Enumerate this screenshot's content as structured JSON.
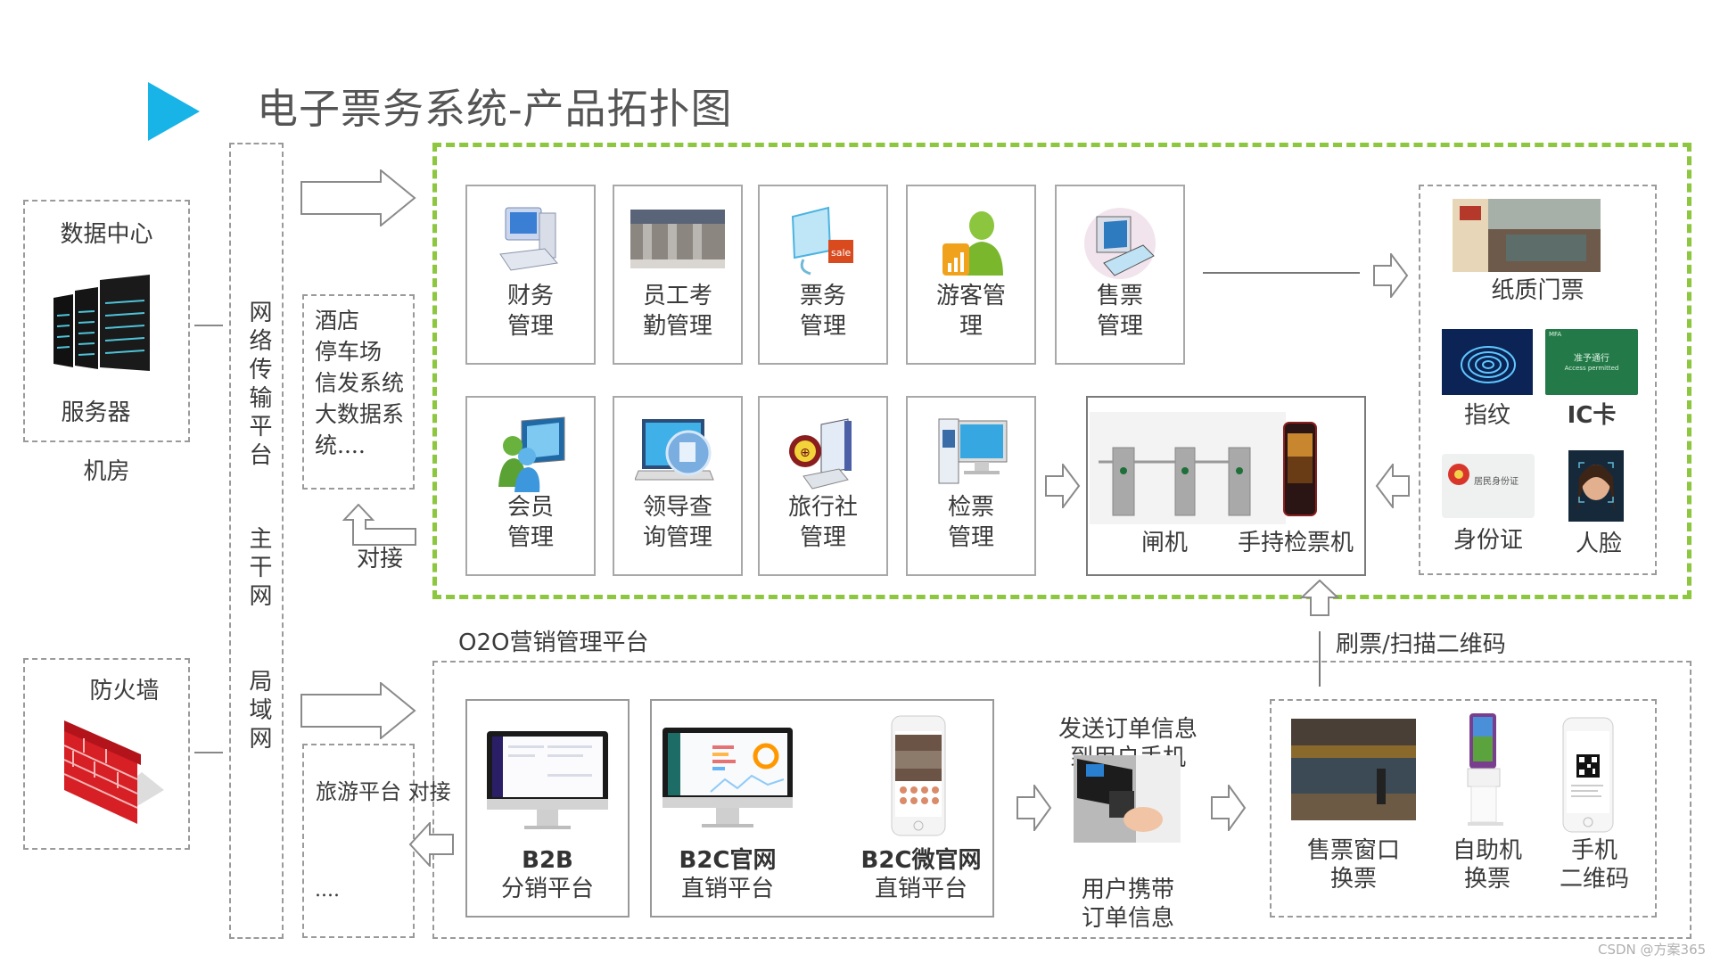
{
  "title": "电子票务系统-产品拓扑图",
  "colors": {
    "accent": "#18B4E8",
    "frame_green": "#8DC63F",
    "dash_gray": "#9a9a9a",
    "text": "#3a3a3a"
  },
  "left": {
    "data_center": {
      "title": "数据中心",
      "server_label": "服务器",
      "caption": "机房"
    },
    "firewall": {
      "title": "防火墙"
    }
  },
  "network_column": {
    "segments": [
      "网络传输平台",
      "主干网",
      "局域网"
    ]
  },
  "external_systems": {
    "lines": [
      "酒店",
      "停车场",
      "信发系统",
      "大数据系",
      "统...."
    ],
    "connect_label": "对接"
  },
  "travel_platform": {
    "label": "旅游平台",
    "connect_label": "对接",
    "more": "...."
  },
  "management_modules": {
    "top_row": [
      {
        "label": "财务\n管理",
        "icon": "computer-icon"
      },
      {
        "label": "员工考\n勤管理",
        "icon": "turnstile-photo-icon"
      },
      {
        "label": "票务\n管理",
        "icon": "monitor-sale-icon"
      },
      {
        "label": "游客管\n理",
        "icon": "visitor-chart-icon"
      },
      {
        "label": "售票\n管理",
        "icon": "ticket-terminal-icon"
      }
    ],
    "bottom_row": [
      {
        "label": "会员\n管理",
        "icon": "member-users-icon"
      },
      {
        "label": "领导查\n询管理",
        "icon": "query-laptop-icon"
      },
      {
        "label": "旅行社\n管理",
        "icon": "travel-agency-pc-icon"
      },
      {
        "label": "检票\n管理",
        "icon": "check-kiosk-icon"
      }
    ]
  },
  "devices": {
    "gate_label": "闸机",
    "handheld_label": "手持检票机"
  },
  "ticket_media": {
    "paper": "纸质门票",
    "fingerprint": "指纹",
    "ic_card": "IC卡",
    "ic_card_text_cn": "准予通行",
    "ic_card_text_en": "Access permitted",
    "ic_card_corner": "MFA",
    "id_card": "身份证",
    "id_card_text": "居民身份证",
    "face": "人脸"
  },
  "o2o": {
    "title": "O2O营销管理平台",
    "b2b": {
      "head": "B2B",
      "sub": "分销平台"
    },
    "b2c_web": {
      "head": "B2C官网",
      "sub": "直销平台"
    },
    "b2c_wechat": {
      "head": "B2C微官网",
      "sub": "直销平台"
    },
    "send_order": "发送订单信息\n到用户手机",
    "carry_order": "用户携带\n订单信息",
    "scan_label": "刷票/扫描二维码",
    "exchange": [
      {
        "label": "售票窗口\n换票"
      },
      {
        "label": "自助机\n换票"
      },
      {
        "label": "手机\n二维码"
      }
    ]
  },
  "watermark": "CSDN @方案365"
}
